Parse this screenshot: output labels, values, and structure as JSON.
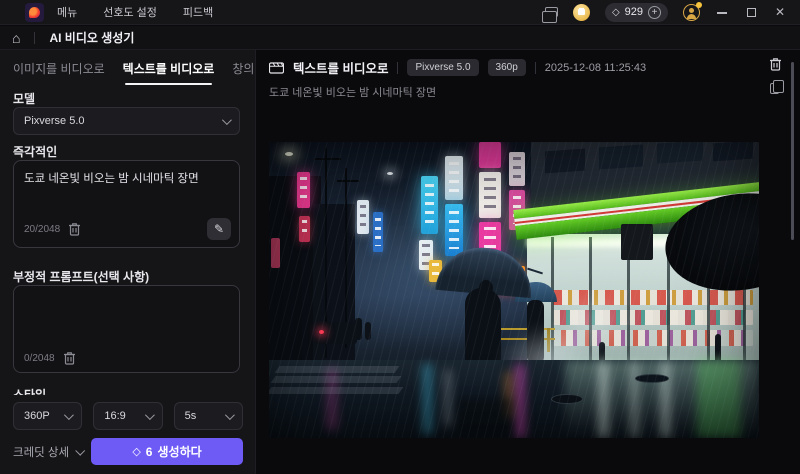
{
  "icons": {
    "home": "⌂",
    "diamond": "◇",
    "plus": "+",
    "close": "✕",
    "pencil": "✎"
  },
  "titlebar": {
    "menu": [
      "메뉴",
      "선호도 설정",
      "피드백"
    ],
    "credits": "929"
  },
  "nav": {
    "title": "AI 비디오 생성기"
  },
  "left_panel": {
    "tabs": [
      {
        "label": "이미지를 비디오로"
      },
      {
        "label": "텍스트를 비디오로"
      },
      {
        "label": "창의적인 효과"
      }
    ],
    "model": {
      "label": "모델",
      "value": "Pixverse 5.0"
    },
    "prompt": {
      "label": "즉각적인",
      "value": "도쿄 네온빛 비오는 밤 시네마틱 장면",
      "counter": "20/2048"
    },
    "negative": {
      "label": "부정적 프롬프트(선택 사항)",
      "value": "",
      "counter": "0/2048"
    },
    "style_label": "스타일",
    "options": {
      "resolution": "360P",
      "ratio": "16:9",
      "duration": "5s"
    },
    "credits_detail": "크레딧 상세",
    "generate": {
      "cost": "6",
      "label": "생성하다"
    }
  },
  "result_panel": {
    "title": "텍스트를 비디오로",
    "badges": [
      "Pixverse 5.0",
      "360p"
    ],
    "timestamp": "2025-12-08 11:25:43",
    "prompt_line": "도쿄 네온빛 비오는 밤 시네마틱 장면"
  },
  "colors": {
    "accent": "#6e5bf6",
    "awning_green": "#6ed321",
    "neon_pink": "#f043b0",
    "neon_cyan": "#3fc9f2"
  }
}
